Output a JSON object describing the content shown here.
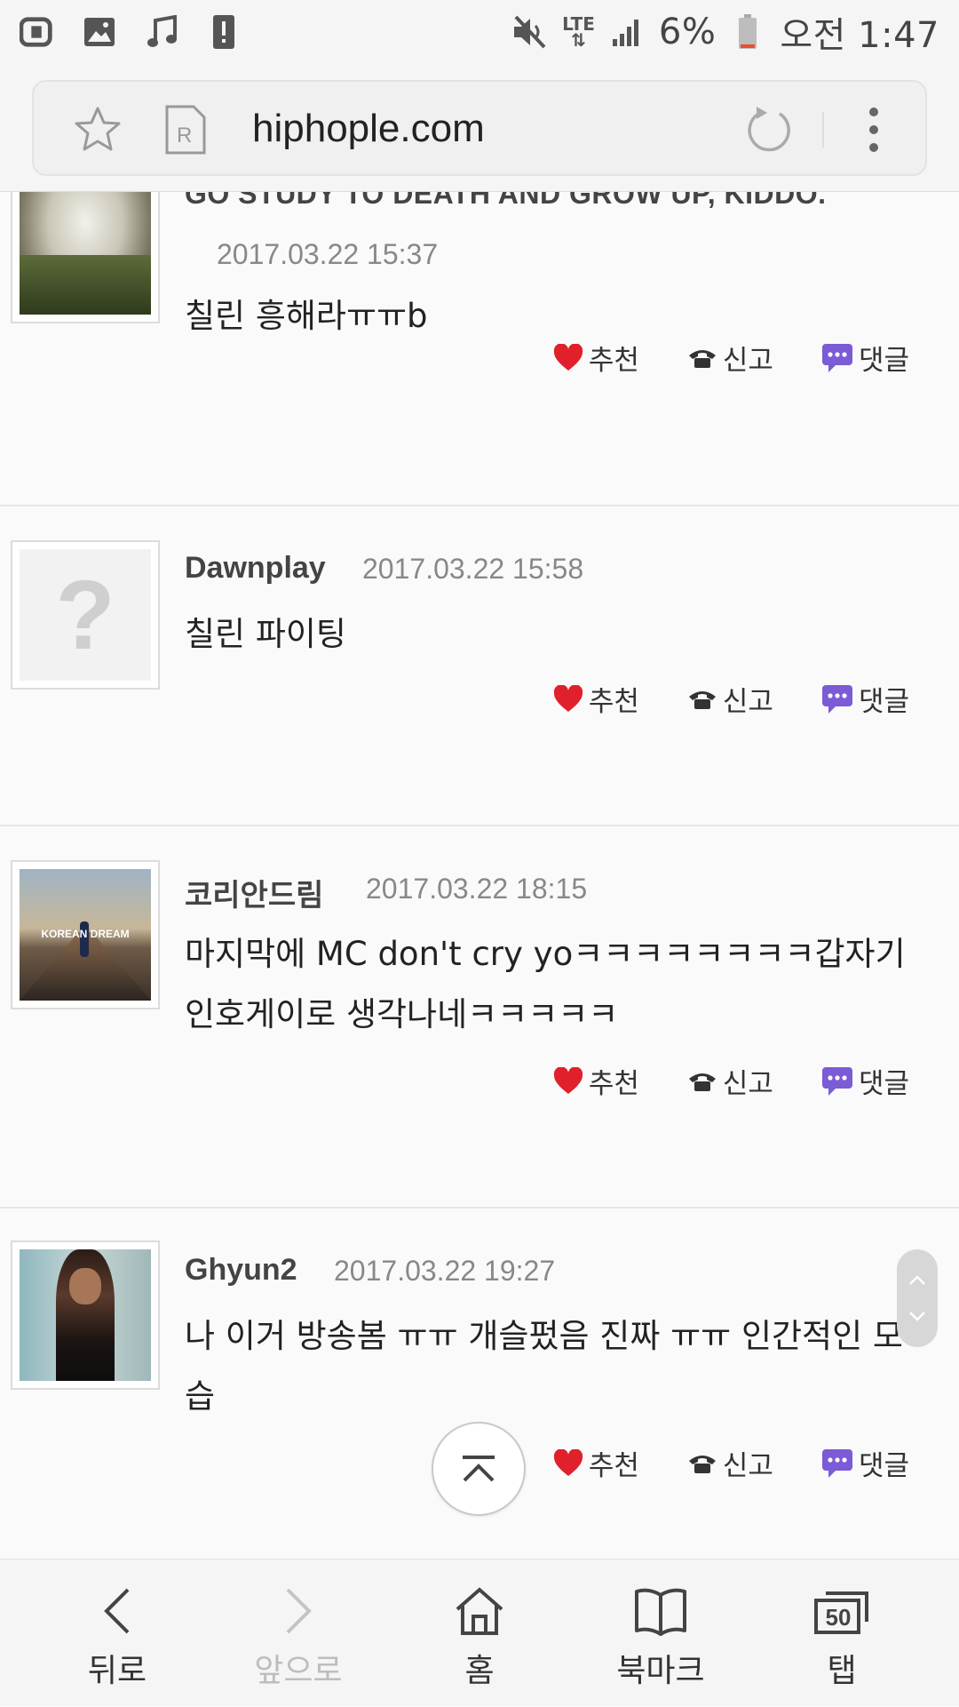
{
  "status_bar": {
    "battery_percent": "6%",
    "network": "LTE",
    "time": "오전 1:47"
  },
  "browser": {
    "url": "hiphople.com"
  },
  "comments": [
    {
      "author": "GO STUDY TO DEATH AND GROW UP, KIDDO.",
      "date": "2017.03.22 15:37",
      "text": "칠린 흥해라ㅠㅠb"
    },
    {
      "author": "Dawnplay",
      "date": "2017.03.22 15:58",
      "text": "칠린 파이팅",
      "avatar_placeholder": "?"
    },
    {
      "author": "코리안드림",
      "date": "2017.03.22 18:15",
      "text": "마지막에 MC don't cry yoㅋㅋㅋㅋㅋㅋㅋㅋ갑자기 인호게이로 생각나네ㅋㅋㅋㅋㅋ",
      "avatar_caption": "KOREAN  DREAM"
    },
    {
      "author": "Ghyun2",
      "date": "2017.03.22 19:27",
      "text": "나 이거 방송봄 ㅠㅠ 개슬펐음 진짜 ㅠㅠ 인간적인 모습"
    }
  ],
  "actions": {
    "recommend": "추천",
    "report": "신고",
    "reply": "댓글"
  },
  "bottom_nav": {
    "back": "뒤로",
    "forward": "앞으로",
    "home": "홈",
    "bookmarks": "북마크",
    "tabs": "탭",
    "tab_count": "50"
  },
  "colors": {
    "heart": "#e0202a",
    "reply_icon": "#7b5bd6"
  }
}
